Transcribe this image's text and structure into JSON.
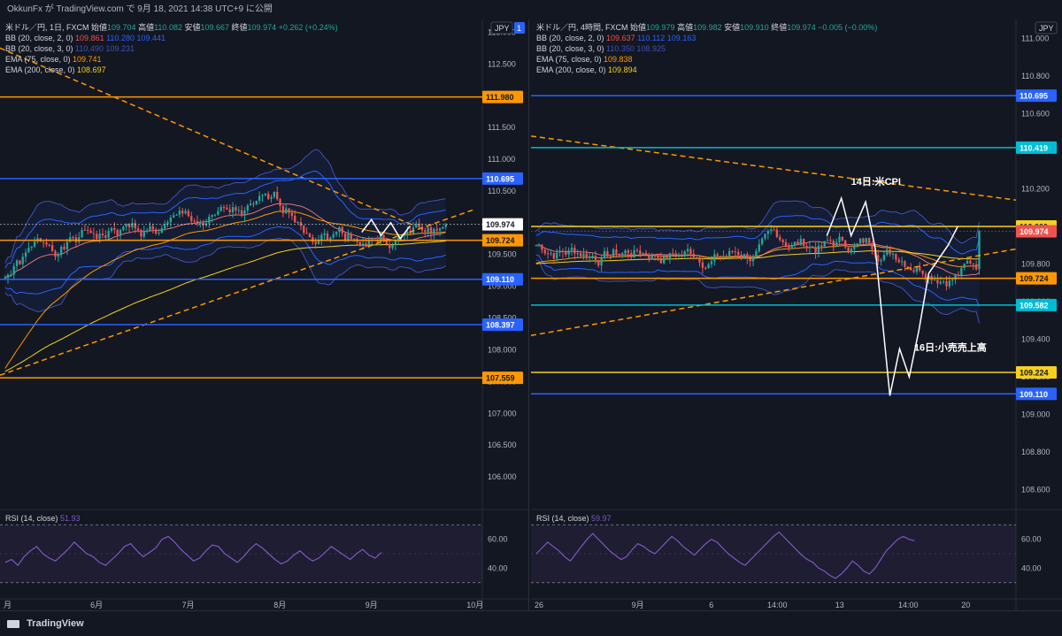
{
  "header": {
    "text": "OkkunFx が TradingView.com で 9月 18, 2021 14:38 UTC+9 に公開"
  },
  "footer": {
    "brand": "TradingView"
  },
  "colors": {
    "bg": "#131722",
    "up": "#26a69a",
    "down": "#ef5350",
    "orange": "#ff9800",
    "blue": "#2962ff",
    "yellow": "#f5d01f",
    "rsi": "#7e57c2",
    "cyan": "#00bcd4"
  },
  "chart_data": [
    {
      "type": "candlestick",
      "title": "米ドル／円, 1日, FXCM",
      "ohlc": {
        "open_label": "始値",
        "open": "109.704",
        "high_label": "高値",
        "high": "110.082",
        "low_label": "安値",
        "low": "109.667",
        "close_label": "終値",
        "close": "109.974",
        "change": "+0.262 (+0.24%)"
      },
      "indicators": [
        {
          "label": "BB (20, close, 2, 0)",
          "values": [
            "109.861",
            "110.280",
            "109.441"
          ]
        },
        {
          "label": "BB (20, close, 3, 0)",
          "values": [
            "110.490",
            "109.231"
          ]
        },
        {
          "label": "EMA (75, close, 0)",
          "values": [
            "109.741"
          ]
        },
        {
          "label": "EMA (200, close, 0)",
          "values": [
            "108.697"
          ]
        }
      ],
      "currency": "JPY",
      "ylim": [
        105.5,
        113.2
      ],
      "y_ticks": [
        "113.000",
        "112.500",
        "112.000",
        "111.500",
        "111.000",
        "110.500",
        "110.000",
        "109.500",
        "109.000",
        "108.500",
        "108.000",
        "107.500",
        "107.000",
        "106.500",
        "106.000"
      ],
      "x_ticks": [
        "月",
        "6月",
        "7月",
        "8月",
        "9月",
        "10月"
      ],
      "x_tick_pos": [
        0.0,
        0.18,
        0.37,
        0.56,
        0.75,
        0.96
      ],
      "price_labels": [
        {
          "label": "111.980",
          "value": 111.98,
          "color": "#ff9800"
        },
        {
          "label": "110.695",
          "value": 110.695,
          "color": "#2962ff"
        },
        {
          "label": "109.974",
          "value": 109.974,
          "color": "#ffffff"
        },
        {
          "label": "109.724",
          "value": 109.724,
          "color": "#ff9800"
        },
        {
          "label": "109.110",
          "value": 109.11,
          "color": "#2962ff"
        },
        {
          "label": "108.397",
          "value": 108.397,
          "color": "#2962ff"
        },
        {
          "label": "107.559",
          "value": 107.559,
          "color": "#ff9800"
        }
      ],
      "trendlines": [
        {
          "from": [
            0.0,
            112.75
          ],
          "to": [
            0.86,
            109.95
          ]
        },
        {
          "from": [
            0.0,
            107.6
          ],
          "to": [
            0.98,
            110.2
          ]
        }
      ],
      "current_price": "109.974",
      "price_scale_tag": "1",
      "rsi": {
        "label": "RSI (14, close)",
        "value": "51.93",
        "ticks": [
          "60.00",
          "40.00"
        ],
        "levels": [
          70,
          30
        ],
        "ylim": [
          20,
          80
        ],
        "values": [
          44,
          46,
          42,
          48,
          52,
          55,
          50,
          47,
          45,
          49,
          53,
          58,
          54,
          50,
          48,
          44,
          42,
          46,
          50,
          55,
          57,
          52,
          48,
          51,
          54,
          60,
          62,
          58,
          53,
          49,
          45,
          47,
          52,
          56,
          55,
          50,
          47,
          44,
          48,
          53,
          57,
          54,
          50,
          46,
          43,
          45,
          49,
          52,
          48,
          45,
          47,
          51,
          55,
          52,
          49,
          46,
          50,
          53,
          49,
          47,
          51
        ]
      }
    },
    {
      "type": "candlestick",
      "title": "米ドル／円, 4時間, FXCM",
      "ohlc": {
        "open_label": "始値",
        "open": "109.979",
        "high_label": "高値",
        "high": "109.982",
        "low_label": "安値",
        "low": "109.910",
        "close_label": "終値",
        "close": "109.974",
        "change": "−0.005 (−0.00%)"
      },
      "indicators": [
        {
          "label": "BB (20, close, 2, 0)",
          "values": [
            "109.637",
            "110.112",
            "109.163"
          ]
        },
        {
          "label": "BB (20, close, 3, 0)",
          "values": [
            "110.350",
            "108.925"
          ]
        },
        {
          "label": "EMA (75, close, 0)",
          "values": [
            "109.838"
          ]
        },
        {
          "label": "EMA (200, close, 0)",
          "values": [
            "109.894"
          ]
        }
      ],
      "currency": "JPY",
      "ylim": [
        108.5,
        111.1
      ],
      "y_ticks": [
        "111.000",
        "110.800",
        "110.600",
        "110.400",
        "110.200",
        "110.000",
        "109.800",
        "109.600",
        "109.400",
        "109.200",
        "109.000",
        "108.800",
        "108.600"
      ],
      "x_ticks": [
        "26",
        "9月",
        "6",
        "14:00",
        "13",
        "14:00",
        "20"
      ],
      "x_tick_pos": [
        0.0,
        0.2,
        0.36,
        0.48,
        0.62,
        0.75,
        0.88
      ],
      "price_labels": [
        {
          "label": "110.695",
          "value": 110.695,
          "color": "#2962ff"
        },
        {
          "label": "110.419",
          "value": 110.419,
          "color": "#00bcd4"
        },
        {
          "label": "110.000",
          "value": 110.0,
          "color": "#f5d01f"
        },
        {
          "label": "109.974",
          "value": 109.974,
          "color": "#ef5350"
        },
        {
          "label": "109.724",
          "value": 109.724,
          "color": "#ff9800"
        },
        {
          "label": "109.582",
          "value": 109.582,
          "color": "#00bcd4"
        },
        {
          "label": "109.224",
          "value": 109.224,
          "color": "#f5d01f"
        },
        {
          "label": "109.110",
          "value": 109.11,
          "color": "#2962ff"
        }
      ],
      "trendlines": [
        {
          "from": [
            0.0,
            110.48
          ],
          "to": [
            1.0,
            110.14
          ]
        },
        {
          "from": [
            0.0,
            109.42
          ],
          "to": [
            1.0,
            109.88
          ]
        }
      ],
      "annotations": [
        "14日:米CPI",
        "16日:小売売上高"
      ],
      "current_price": "109.974",
      "rsi": {
        "label": "RSI (14, close)",
        "value": "59.97",
        "ticks": [
          "60.00",
          "40.00"
        ],
        "levels": [
          70,
          30
        ],
        "ylim": [
          20,
          80
        ],
        "values": [
          50,
          54,
          58,
          55,
          52,
          48,
          45,
          50,
          55,
          60,
          64,
          60,
          56,
          52,
          49,
          46,
          48,
          53,
          57,
          55,
          52,
          50,
          54,
          58,
          62,
          59,
          55,
          52,
          49,
          53,
          57,
          60,
          58,
          54,
          50,
          47,
          44,
          42,
          46,
          50,
          54,
          58,
          62,
          65,
          61,
          57,
          53,
          49,
          46,
          44,
          40,
          38,
          35,
          33,
          36,
          40,
          45,
          42,
          38,
          36,
          40,
          46,
          52,
          56,
          60,
          62,
          60,
          59
        ]
      }
    }
  ]
}
